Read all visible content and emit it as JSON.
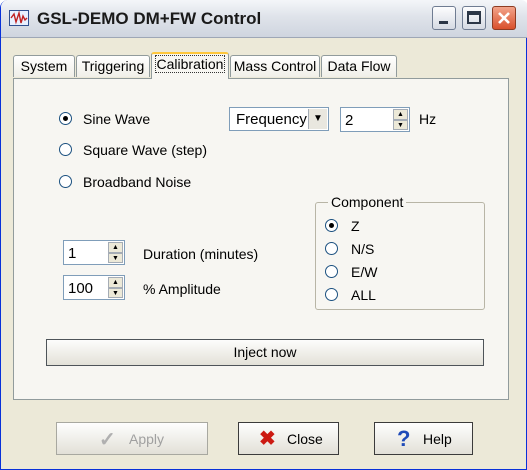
{
  "window": {
    "title": "GSL-DEMO DM+FW Control",
    "app_icon": "waveform-app-icon"
  },
  "tabs": [
    {
      "label": "System",
      "active": false
    },
    {
      "label": "Triggering",
      "active": false
    },
    {
      "label": "Calibration",
      "active": true
    },
    {
      "label": "Mass Control",
      "active": false
    },
    {
      "label": "Data Flow",
      "active": false
    }
  ],
  "signal": {
    "options": [
      "Sine Wave",
      "Square Wave (step)",
      "Broadband Noise"
    ],
    "selected": "Sine Wave"
  },
  "parameter": {
    "selected": "Frequency",
    "value": "2",
    "unit": "Hz"
  },
  "duration": {
    "value": "1",
    "label": "Duration (minutes)"
  },
  "amplitude": {
    "value": "100",
    "label": "% Amplitude"
  },
  "component": {
    "title": "Component",
    "options": [
      "Z",
      "N/S",
      "E/W",
      "ALL"
    ],
    "selected": "Z"
  },
  "inject_label": "Inject now",
  "footer": {
    "apply_label": "Apply",
    "close_label": "Close",
    "help_label": "Help"
  }
}
